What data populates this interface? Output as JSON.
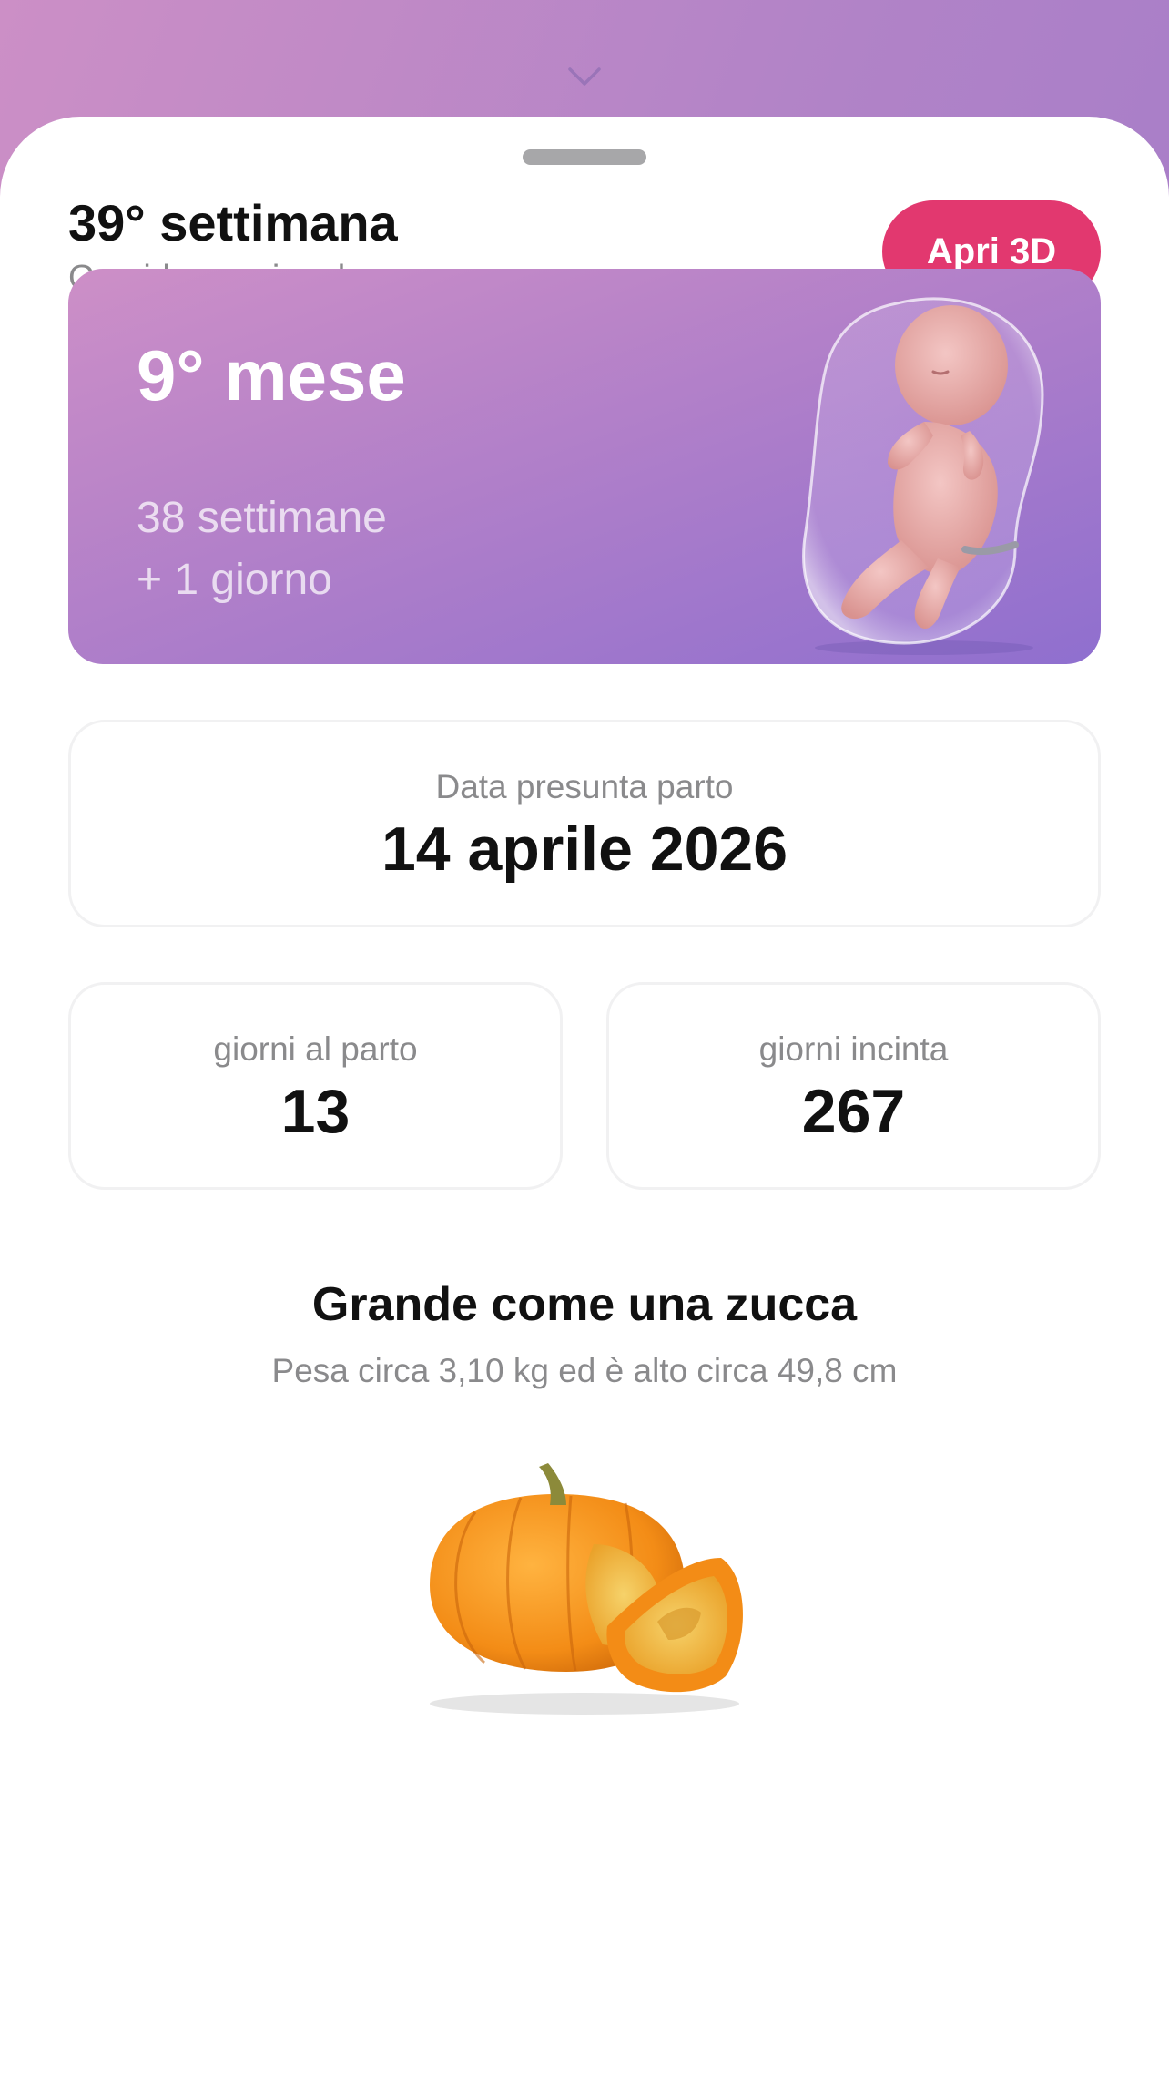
{
  "header": {
    "week_title": "39° settimana",
    "pregnancy_type": "Gravidanza singola",
    "open_3d_label": "Apri 3D"
  },
  "month_card": {
    "month_title": "9° mese",
    "weeks_line": "38 settimane",
    "days_line": "+ 1 giorno"
  },
  "due_date": {
    "label": "Data presunta parto",
    "value": "14 aprile 2026"
  },
  "stats": {
    "days_to_birth_label": "giorni al parto",
    "days_to_birth_value": "13",
    "days_pregnant_label": "giorni incinta",
    "days_pregnant_value": "267"
  },
  "size_comparison": {
    "title": "Grande come una zucca",
    "detail": "Pesa circa 3,10 kg ed è alto circa 49,8 cm",
    "fruit_icon": "pumpkin-icon"
  },
  "colors": {
    "accent": "#e2386f",
    "gradient_start": "#cd8fc7",
    "gradient_end": "#8f6fcf"
  }
}
